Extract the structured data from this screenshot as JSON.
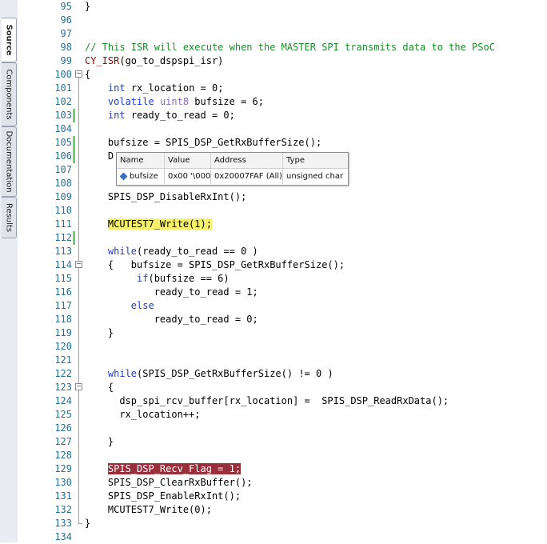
{
  "sidebar": {
    "tabs": [
      {
        "label": "Source",
        "active": true
      },
      {
        "label": "Components"
      },
      {
        "label": "Documentation"
      },
      {
        "label": "Results"
      }
    ]
  },
  "tooltip": {
    "headers": [
      "Name",
      "Value",
      "Address",
      "Type"
    ],
    "row": {
      "name": "bufsize",
      "value": "0x00 '\\000'",
      "address": "0x20007FAF (All)",
      "type": "unsigned char"
    }
  },
  "lines": [
    {
      "n": "95",
      "t": [
        [
          "}",
          ""
        ]
      ]
    },
    {
      "n": "96",
      "t": []
    },
    {
      "n": "97",
      "t": []
    },
    {
      "n": "98",
      "t": [
        [
          "// This ISR will execute when the MASTER SPI transmits data to the PSoC",
          "cm"
        ]
      ]
    },
    {
      "n": "99",
      "t": [
        [
          "CY_ISR",
          "mac"
        ],
        [
          "(go_to_dspspi_isr)",
          ""
        ]
      ]
    },
    {
      "n": "100",
      "t": [
        [
          "{",
          ""
        ]
      ]
    },
    {
      "n": "101",
      "t": [
        [
          "    ",
          ""
        ],
        [
          "int",
          "kw"
        ],
        [
          " rx_location = 0;",
          ""
        ]
      ]
    },
    {
      "n": "102",
      "t": [
        [
          "    ",
          ""
        ],
        [
          "volatile",
          "kw"
        ],
        [
          " ",
          ""
        ],
        [
          "uint8",
          "ty"
        ],
        [
          " bufsize = 6;",
          ""
        ]
      ]
    },
    {
      "n": "103",
      "t": [
        [
          "    ",
          ""
        ],
        [
          "int",
          "kw"
        ],
        [
          " ready_to_read = 0;",
          ""
        ]
      ]
    },
    {
      "n": "104",
      "t": []
    },
    {
      "n": "105",
      "t": [
        [
          "    bufsize = SPIS_DSP_GetRxBufferSize();",
          ""
        ]
      ]
    },
    {
      "n": "106",
      "t": [
        [
          "    D",
          ""
        ]
      ]
    },
    {
      "n": "107",
      "t": []
    },
    {
      "n": "108",
      "t": []
    },
    {
      "n": "109",
      "t": [
        [
          "    SPIS_DSP_DisableRxInt();",
          ""
        ]
      ]
    },
    {
      "n": "110",
      "t": []
    },
    {
      "n": "111",
      "t": [
        [
          "    ",
          ""
        ],
        [
          "MCUTEST7_Write(1);",
          "hl-yellow"
        ]
      ]
    },
    {
      "n": "112",
      "t": []
    },
    {
      "n": "113",
      "t": [
        [
          "    ",
          ""
        ],
        [
          "while",
          "kw"
        ],
        [
          "(ready_to_read == 0 )",
          ""
        ]
      ]
    },
    {
      "n": "114",
      "t": [
        [
          "    {   bufsize = SPIS_DSP_GetRxBufferSize();",
          ""
        ]
      ]
    },
    {
      "n": "115",
      "t": [
        [
          "         ",
          ""
        ],
        [
          "if",
          "kw"
        ],
        [
          "(bufsize == 6)",
          ""
        ]
      ]
    },
    {
      "n": "116",
      "t": [
        [
          "            ready_to_read = 1;",
          ""
        ]
      ]
    },
    {
      "n": "117",
      "t": [
        [
          "        ",
          ""
        ],
        [
          "else",
          "kw"
        ]
      ]
    },
    {
      "n": "118",
      "t": [
        [
          "            ready_to_read = 0;",
          ""
        ]
      ]
    },
    {
      "n": "119",
      "t": [
        [
          "    }",
          ""
        ]
      ]
    },
    {
      "n": "120",
      "t": []
    },
    {
      "n": "121",
      "t": []
    },
    {
      "n": "122",
      "t": [
        [
          "    ",
          ""
        ],
        [
          "while",
          "kw"
        ],
        [
          "(SPIS_DSP_GetRxBufferSize() != 0 )",
          ""
        ]
      ]
    },
    {
      "n": "123",
      "t": [
        [
          "    {",
          ""
        ]
      ]
    },
    {
      "n": "124",
      "t": [
        [
          "      dsp_spi_rcv_buffer[rx_location] =  SPIS_DSP_ReadRxData();",
          ""
        ]
      ]
    },
    {
      "n": "125",
      "t": [
        [
          "      rx_location++;",
          ""
        ]
      ]
    },
    {
      "n": "126",
      "t": []
    },
    {
      "n": "127",
      "t": [
        [
          "    }",
          ""
        ]
      ]
    },
    {
      "n": "128",
      "t": []
    },
    {
      "n": "129",
      "t": [
        [
          "    ",
          ""
        ],
        [
          "SPIS_DSP_Recv_Flag = 1;",
          "hl-red"
        ]
      ]
    },
    {
      "n": "130",
      "t": [
        [
          "    SPIS_DSP_ClearRxBuffer();",
          ""
        ]
      ]
    },
    {
      "n": "131",
      "t": [
        [
          "    SPIS_DSP_EnableRxInt();",
          ""
        ]
      ]
    },
    {
      "n": "132",
      "t": [
        [
          "    MCUTEST7_Write(0);",
          ""
        ]
      ]
    },
    {
      "n": "133",
      "t": [
        [
          "}",
          ""
        ]
      ]
    },
    {
      "n": "134",
      "t": []
    }
  ]
}
